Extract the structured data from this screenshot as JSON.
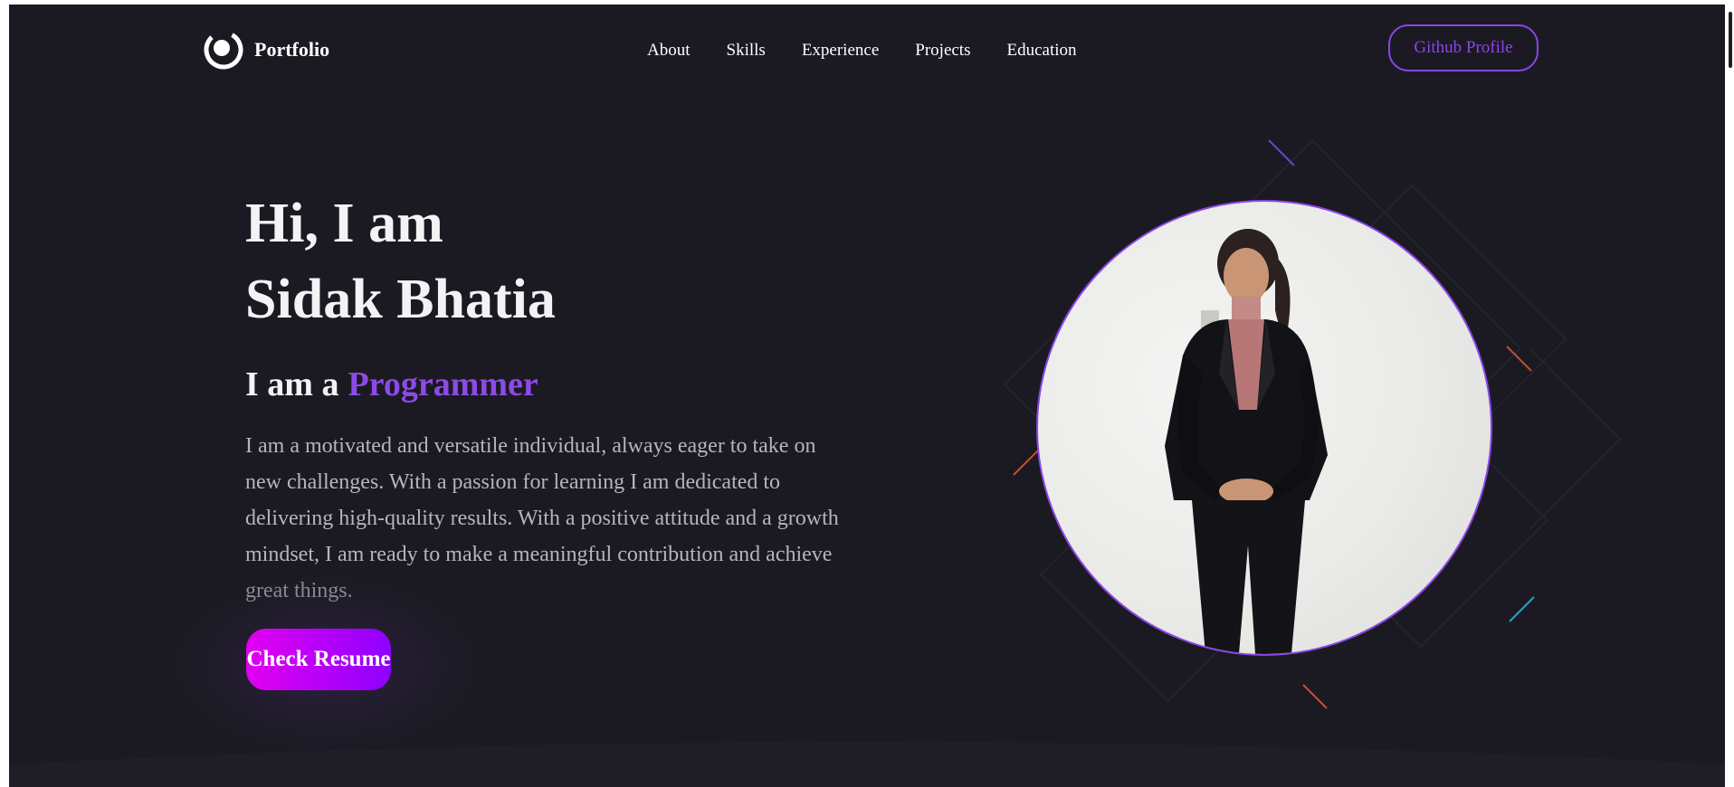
{
  "nav": {
    "logo_text": "Portfolio",
    "links": [
      "About",
      "Skills",
      "Experience",
      "Projects",
      "Education"
    ],
    "cta_label": "Github Profile"
  },
  "hero": {
    "greeting": "Hi, I am",
    "name": "Sidak Bhatia",
    "role_prefix": "I am a",
    "role": "Programmer",
    "bio_lines": [
      "I am a motivated and versatile individual, always eager to take on",
      "new challenges. With a passion for learning I am dedicated to",
      "delivering high-quality results. With a positive attitude and a growth",
      "mindset, I am ready to make a meaningful contribution and achieve",
      "great things."
    ],
    "resume_button": "Check Resume"
  },
  "colors": {
    "background": "#1b1a22",
    "accent": "#8b45e6",
    "button_gradient_start": "#e200f0",
    "button_gradient_end": "#8f00ff"
  },
  "icons": {
    "logo": "portfolio-logo-icon"
  }
}
